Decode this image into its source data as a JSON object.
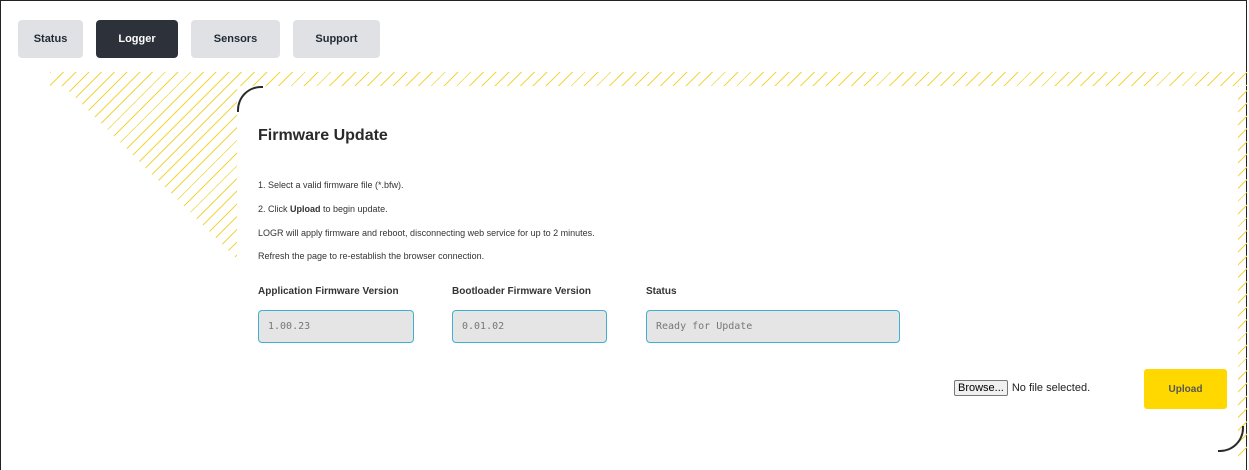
{
  "tabs": [
    {
      "label": "Status",
      "active": false
    },
    {
      "label": "Logger",
      "active": true
    },
    {
      "label": "Sensors",
      "active": false
    },
    {
      "label": "Support",
      "active": false
    }
  ],
  "firmware": {
    "title": "Firmware Update",
    "instructions": {
      "step1": "1. Select a valid firmware file (*.bfw).",
      "step2_prefix": "2. Click ",
      "step2_bold": "Upload",
      "step2_suffix": " to begin update.",
      "line3": "LOGR will apply firmware and reboot, disconnecting web service for up to 2 minutes.",
      "line4": "Refresh the page to re-establish the browser connection."
    },
    "fields": {
      "app_label": "Application Firmware Version",
      "app_value": "1.00.23",
      "boot_label": "Bootloader Firmware Version",
      "boot_value": "0.01.02",
      "status_label": "Status",
      "status_value": "Ready for Update"
    },
    "file": {
      "browse_label": "Browse...",
      "no_file_text": "No file selected."
    },
    "upload_label": "Upload"
  },
  "colors": {
    "accent_yellow": "#ffd800",
    "field_border": "#3fb0cf",
    "active_tab": "#2d323a"
  }
}
